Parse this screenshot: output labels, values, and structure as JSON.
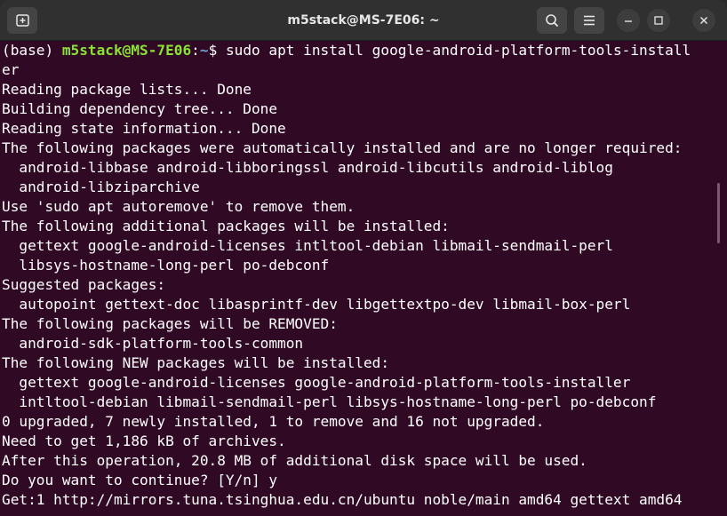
{
  "window": {
    "title": "m5stack@MS-7E06: ~"
  },
  "titlebar": {
    "new_tab_icon": "new-tab-icon",
    "search_icon": "search-icon",
    "menu_icon": "hamburger-menu-icon",
    "minimize_icon": "minimize-icon",
    "maximize_icon": "maximize-icon",
    "close_icon": "close-icon"
  },
  "prompt": {
    "env": "(base) ",
    "user_host": "m5stack@MS-7E06",
    "colon": ":",
    "path": "~",
    "dollar": "$ ",
    "command": "sudo apt install google-android-platform-tools-install",
    "command_wrap": "er"
  },
  "output": [
    "Reading package lists... Done",
    "Building dependency tree... Done",
    "Reading state information... Done",
    "The following packages were automatically installed and are no longer required:",
    "  android-libbase android-libboringssl android-libcutils android-liblog",
    "  android-libziparchive",
    "Use 'sudo apt autoremove' to remove them.",
    "The following additional packages will be installed:",
    "  gettext google-android-licenses intltool-debian libmail-sendmail-perl",
    "  libsys-hostname-long-perl po-debconf",
    "Suggested packages:",
    "  autopoint gettext-doc libasprintf-dev libgettextpo-dev libmail-box-perl",
    "The following packages will be REMOVED:",
    "  android-sdk-platform-tools-common",
    "The following NEW packages will be installed:",
    "  gettext google-android-licenses google-android-platform-tools-installer",
    "  intltool-debian libmail-sendmail-perl libsys-hostname-long-perl po-debconf",
    "0 upgraded, 7 newly installed, 1 to remove and 16 not upgraded.",
    "Need to get 1,186 kB of archives.",
    "After this operation, 20.8 MB of additional disk space will be used.",
    "Do you want to continue? [Y/n] y",
    "Get:1 http://mirrors.tuna.tsinghua.edu.cn/ubuntu noble/main amd64 gettext amd64"
  ],
  "colors": {
    "background": "#300a24",
    "prompt_user": "#8ae234",
    "prompt_path": "#729fcf",
    "text": "#ffffff"
  }
}
